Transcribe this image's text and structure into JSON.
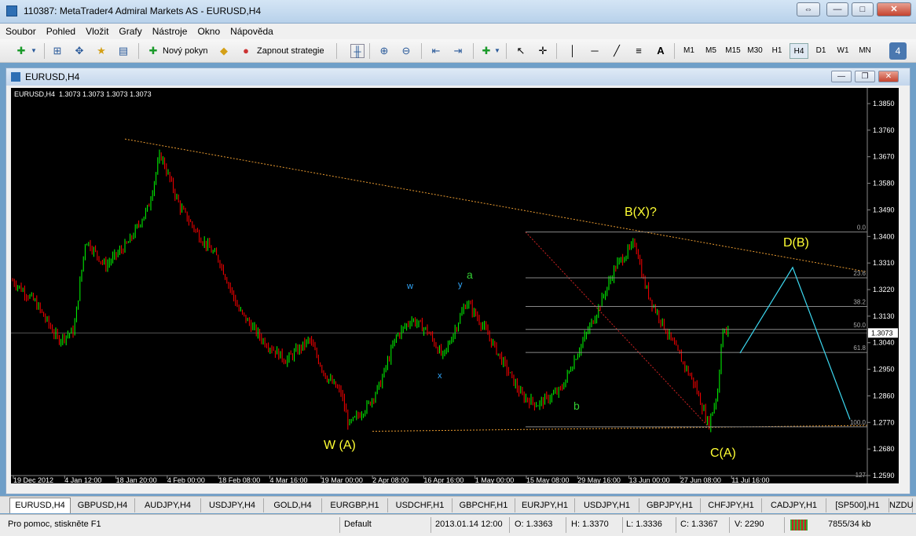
{
  "window": {
    "title": "110387: MetaTrader4 Admiral Markets AS - EURUSD,H4"
  },
  "menu": [
    "Soubor",
    "Pohled",
    "Vložit",
    "Grafy",
    "Nástroje",
    "Okno",
    "Nápověda"
  ],
  "toolbar": {
    "new_order": "Nový pokyn",
    "auto_trading": "Zapnout strategie",
    "text_tool": "A",
    "timeframes": [
      "M1",
      "M5",
      "M15",
      "M30",
      "H1",
      "H4",
      "D1",
      "W1",
      "MN"
    ],
    "active_timeframe": "H4",
    "badge": "4"
  },
  "chart_window": {
    "title": "EURUSD,H4"
  },
  "chart_data": {
    "type": "candlestick",
    "info": "EURUSD,H4  1.3073 1.3073 1.3073 1.3073",
    "current_price": "1.3073",
    "price_labels": [
      "1.3850",
      "1.3760",
      "1.3670",
      "1.3580",
      "1.3490",
      "1.3400",
      "1.3310",
      "1.3220",
      "1.3130",
      "1.3040",
      "1.2950",
      "1.2860",
      "1.2770",
      "1.2680",
      "1.2590"
    ],
    "date_labels": [
      "19 Dec 2012",
      "4 Jan 12:00",
      "18 Jan 20:00",
      "4 Feb 00:00",
      "18 Feb 08:00",
      "4 Mar 16:00",
      "19 Mar 00:00",
      "2 Apr 08:00",
      "16 Apr 16:00",
      "1 May 00:00",
      "15 May 08:00",
      "29 May 16:00",
      "13 Jun 00:00",
      "27 Jun 08:00",
      "11 Jul 16:00"
    ],
    "fib_levels": [
      "0.0",
      "23.6",
      "38.2",
      "50.0",
      "61.8",
      "100.0",
      "127"
    ],
    "wave_labels": [
      {
        "text": "W (A)",
        "color": "#ffff33"
      },
      {
        "text": "w",
        "color": "#33aaff"
      },
      {
        "text": "x",
        "color": "#33aaff"
      },
      {
        "text": "y",
        "color": "#33aaff"
      },
      {
        "text": "a",
        "color": "#33cc33"
      },
      {
        "text": "b",
        "color": "#33cc33"
      },
      {
        "text": "B(X)?",
        "color": "#ffff33"
      },
      {
        "text": "C(A)",
        "color": "#ffff33"
      },
      {
        "text": "D(B)",
        "color": "#ffff33"
      }
    ],
    "up_color": "#00ff00",
    "down_color": "#ff0000"
  },
  "tabs": [
    "EURUSD,H4",
    "GBPUSD,H4",
    "AUDJPY,H4",
    "USDJPY,H4",
    "GOLD,H4",
    "EURGBP,H1",
    "USDCHF,H1",
    "GBPCHF,H1",
    "EURJPY,H1",
    "USDJPY,H1",
    "GBPJPY,H1",
    "CHFJPY,H1",
    "CADJPY,H1",
    "[SP500],H1",
    "NZDU"
  ],
  "status": {
    "help": "Pro pomoc, stiskněte F1",
    "profile": "Default",
    "datetime": "2013.01.14 12:00",
    "open": "O: 1.3363",
    "high": "H: 1.3370",
    "low": "L: 1.3336",
    "close": "C: 1.3367",
    "volume": "V: 2290",
    "traffic": "7855/34 kb"
  }
}
